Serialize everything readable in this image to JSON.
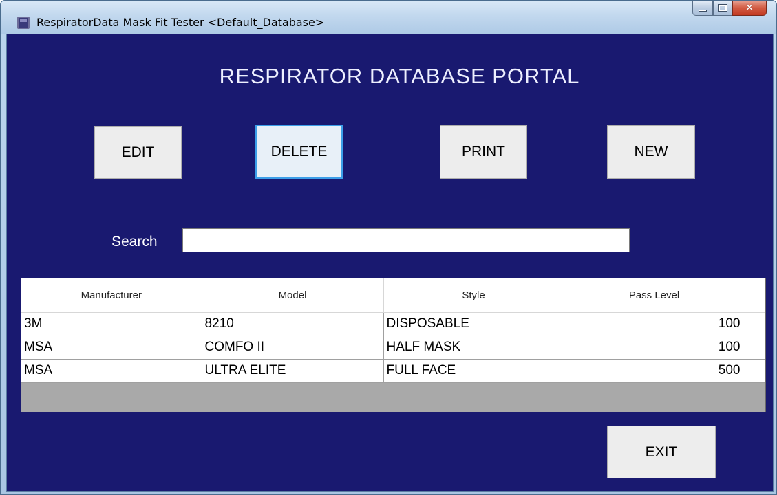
{
  "window": {
    "title": "RespiratorData Mask Fit Tester <Default_Database>",
    "caption_buttons": [
      "minimize",
      "maximize",
      "close"
    ]
  },
  "portal": {
    "title": "RESPIRATOR DATABASE PORTAL"
  },
  "toolbar": {
    "edit_label": "EDIT",
    "delete_label": "DELETE",
    "print_label": "PRINT",
    "new_label": "NEW"
  },
  "search": {
    "label": "Search",
    "value": "",
    "placeholder": ""
  },
  "grid": {
    "columns": [
      "Manufacturer",
      "Model",
      "Style",
      "Pass Level"
    ],
    "rows": [
      {
        "manufacturer": "3M",
        "model": "8210",
        "style": "DISPOSABLE",
        "pass_level": "100"
      },
      {
        "manufacturer": "MSA",
        "model": "COMFO II",
        "style": "HALF MASK",
        "pass_level": "100"
      },
      {
        "manufacturer": "MSA",
        "model": "ULTRA ELITE",
        "style": "FULL FACE",
        "pass_level": "500"
      }
    ]
  },
  "footer": {
    "exit_label": "EXIT"
  },
  "colors": {
    "client_background": "#191970",
    "focused_border": "#3c9ee8",
    "close_button": "#c23a22"
  }
}
